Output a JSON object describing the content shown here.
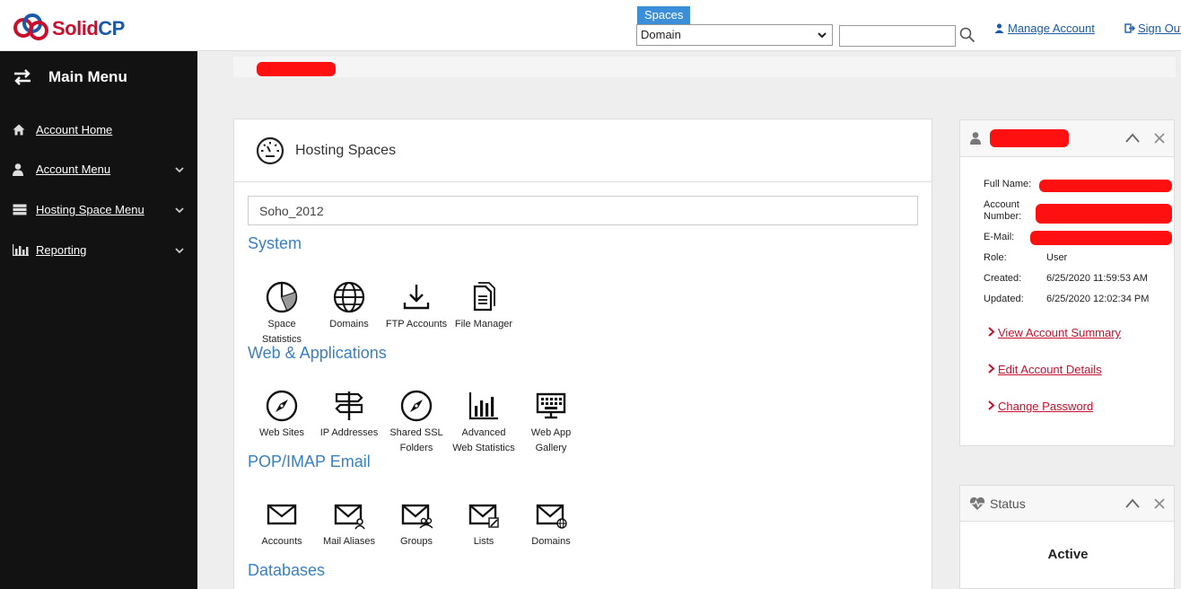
{
  "header": {
    "logo_text_a": "Solid",
    "logo_text_b": "CP",
    "spaces_label": "Spaces",
    "spaces_selected": "Domain",
    "search_value": "",
    "manage_account": "Manage Account",
    "sign_out": "Sign Out"
  },
  "sidebar": {
    "title": "Main Menu",
    "items": [
      {
        "label": "Account Home",
        "icon": "home-icon"
      },
      {
        "label": "Account Menu",
        "icon": "user-icon"
      },
      {
        "label": "Hosting Space Menu",
        "icon": "server-icon"
      },
      {
        "label": "Reporting",
        "icon": "bar-chart-icon"
      }
    ]
  },
  "hosting": {
    "title": "Hosting Spaces",
    "space_name": "Soho_2012",
    "sections": {
      "system": {
        "title": "System",
        "items": [
          "Space Statistics",
          "Domains",
          "FTP Accounts",
          "File Manager"
        ]
      },
      "web": {
        "title": "Web & Applications",
        "items": [
          "Web Sites",
          "IP Addresses",
          "Shared SSL Folders",
          "Advanced Web Statistics",
          "Web App Gallery"
        ]
      },
      "email": {
        "title": "POP/IMAP Email",
        "items": [
          "Accounts",
          "Mail Aliases",
          "Groups",
          "Lists",
          "Domains"
        ]
      },
      "databases": {
        "title": "Databases"
      }
    }
  },
  "account_card": {
    "labels": {
      "full_name": "Full Name:",
      "account_number": "Account Number:",
      "email": "E-Mail:",
      "role": "Role:",
      "created": "Created:",
      "updated": "Updated:"
    },
    "values": {
      "role": "User",
      "created": "6/25/2020 11:59:53 AM",
      "updated": "6/25/2020 12:02:34 PM"
    },
    "links": {
      "view_summary": "View Account Summary",
      "edit_details": "Edit Account Details",
      "change_password": "Change Password"
    }
  },
  "status_card": {
    "title": "Status",
    "value": "Active"
  },
  "colors": {
    "brand_red": "#c8102e",
    "brand_blue": "#1a5aa8",
    "section_blue": "#3a80c2",
    "sidebar_bg": "#121212"
  }
}
